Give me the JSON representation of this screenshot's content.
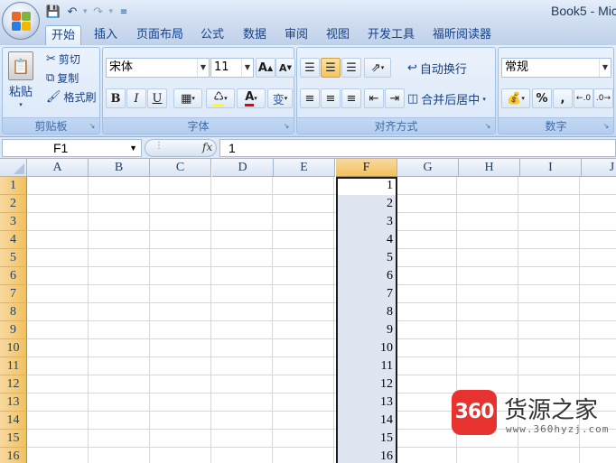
{
  "window": {
    "title": "Book5 - Mic"
  },
  "tabs": [
    {
      "label": "开始",
      "active": true
    },
    {
      "label": "插入"
    },
    {
      "label": "页面布局"
    },
    {
      "label": "公式"
    },
    {
      "label": "数据"
    },
    {
      "label": "审阅"
    },
    {
      "label": "视图"
    },
    {
      "label": "开发工具"
    },
    {
      "label": "福昕阅读器"
    }
  ],
  "clipboard": {
    "paste": "粘贴",
    "cut": "剪切",
    "copy": "复制",
    "format_painter": "格式刷",
    "label": "剪贴板"
  },
  "font": {
    "name": "宋体",
    "size": "11",
    "label": "字体",
    "bold": "B",
    "italic": "I",
    "underline": "U",
    "font_color_letter": "A",
    "phonetic": "变"
  },
  "alignment": {
    "wrap_text": "自动换行",
    "merge_center": "合并后居中",
    "label": "对齐方式"
  },
  "number": {
    "format": "常规",
    "percent": "%",
    "comma": ",",
    "label": "数字"
  },
  "formula_bar": {
    "name_box": "F1",
    "fx": "fx",
    "value": "1"
  },
  "grid": {
    "columns": [
      "A",
      "B",
      "C",
      "D",
      "E",
      "F",
      "G",
      "H",
      "I",
      "J"
    ],
    "rows": [
      "1",
      "2",
      "3",
      "4",
      "5",
      "6",
      "7",
      "8",
      "9",
      "10",
      "11",
      "12",
      "13",
      "14",
      "15",
      "16"
    ],
    "selected_column": "F",
    "column_f_values": [
      "1",
      "2",
      "3",
      "4",
      "5",
      "6",
      "7",
      "8",
      "9",
      "10",
      "11",
      "12",
      "13",
      "14",
      "15",
      "16"
    ]
  },
  "watermark": {
    "logo": "360",
    "name": "货源之家",
    "url": "www.360hyzj.com"
  },
  "colors": {
    "accent": "#15428b",
    "selection": "#f1c15f",
    "watermark_red": "#e8322f"
  }
}
